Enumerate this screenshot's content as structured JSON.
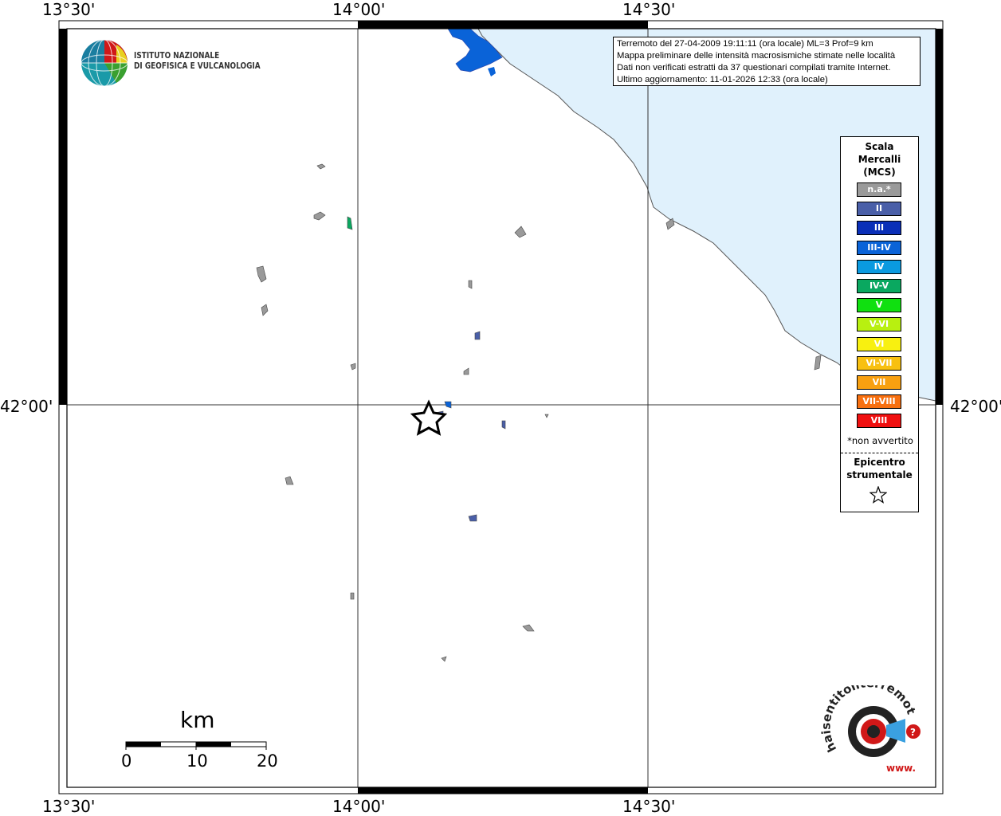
{
  "axes": {
    "top_labels": [
      "13°30'",
      "14°00'",
      "14°30'"
    ],
    "bottom_labels": [
      "13°30'",
      "14°00'",
      "14°30'"
    ],
    "left_label": "42°00'",
    "right_label": "42°00'"
  },
  "institute_logo": {
    "line1": "ISTITUTO NAZIONALE",
    "line2": "DI GEOFISICA E VULCANOLOGIA"
  },
  "info": {
    "line1": "Terremoto del 27-04-2009 19:11:11 (ora locale) ML=3 Prof=9 km",
    "line2": "Mappa preliminare delle intensità macrosismiche stimate nelle località",
    "line3": "Dati non verificati estratti da 37 questionari compilati tramite Internet.",
    "line4": "Ultimo aggiornamento: 11-01-2026 12:33 (ora locale)"
  },
  "legend": {
    "title1": "Scala",
    "title2": "Mercalli",
    "title3": "(MCS)",
    "items": [
      {
        "label": "n.a.*",
        "color": "#9a9a9a"
      },
      {
        "label": "II",
        "color": "#4a5fa8"
      },
      {
        "label": "III",
        "color": "#0a2fb8"
      },
      {
        "label": "III-IV",
        "color": "#0a63d8"
      },
      {
        "label": "IV",
        "color": "#0a9ae0"
      },
      {
        "label": "IV-V",
        "color": "#0aa860"
      },
      {
        "label": "V",
        "color": "#10e010"
      },
      {
        "label": "V-VI",
        "color": "#b8f010"
      },
      {
        "label": "VI",
        "color": "#f8f010"
      },
      {
        "label": "VI-VII",
        "color": "#f8c010"
      },
      {
        "label": "VII",
        "color": "#f8a010"
      },
      {
        "label": "VII-VIII",
        "color": "#f87010"
      },
      {
        "label": "VIII",
        "color": "#f01010"
      }
    ],
    "note": "*non avvertito",
    "epicenter1": "Epicentro",
    "epicenter2": "strumentale"
  },
  "scale_bar": {
    "unit": "km",
    "ticks": [
      "0",
      "10",
      "20"
    ]
  },
  "hsit_logo": {
    "text": "haisentitoilterremoto.it",
    "prefix": "www."
  },
  "colors": {
    "sea": "#e0f1fc",
    "coast": "#555555",
    "frame": "#000000"
  }
}
